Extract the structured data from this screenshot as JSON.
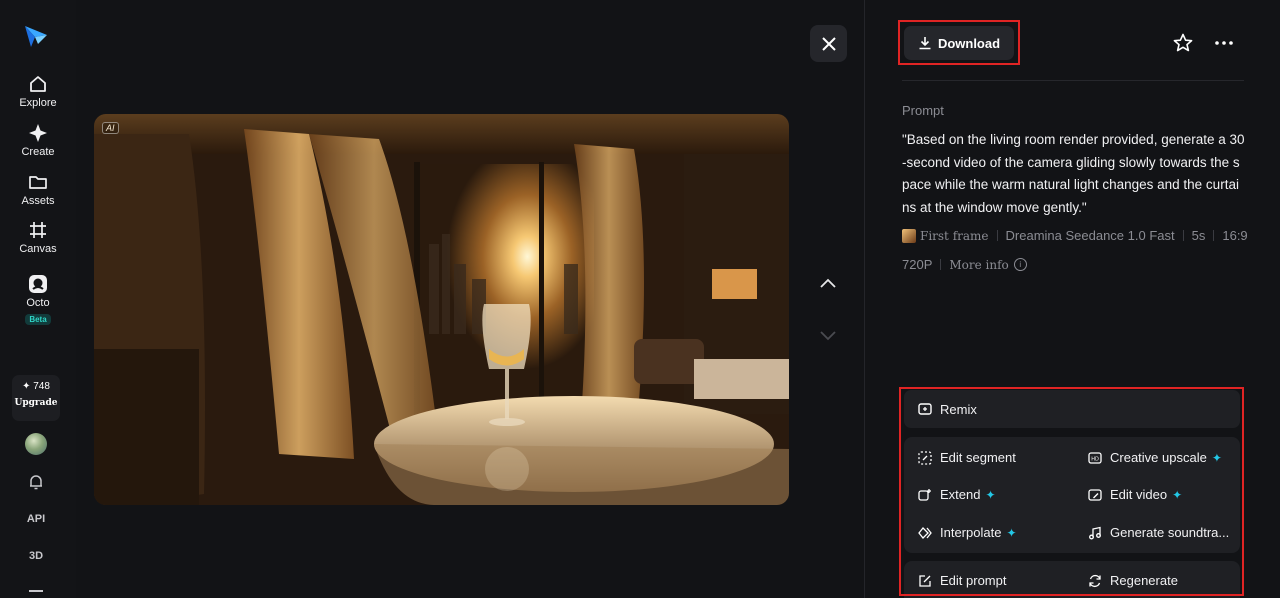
{
  "rail": {
    "nav": [
      {
        "label": "Explore",
        "icon": "home-icon"
      },
      {
        "label": "Create",
        "icon": "sparkle-icon"
      },
      {
        "label": "Assets",
        "icon": "folder-icon"
      },
      {
        "label": "Canvas",
        "icon": "canvas-icon"
      },
      {
        "label": "Octo",
        "icon": "octo-icon"
      }
    ],
    "octo_badge": "Beta",
    "credits": "748",
    "upgrade": "Upgrade",
    "api": "API",
    "three_d": "3D"
  },
  "viewer": {
    "ai_badge": "AI"
  },
  "panel": {
    "download": "Download",
    "prompt_label": "Prompt",
    "prompt_text": "\"Based on the living room render provided, generate a 30-second video of the camera gliding slowly towards the space while the warm natural light changes and the curtains at the window move gently.\"",
    "meta": {
      "first_frame": "First frame",
      "model": "Dreamina Seedance 1.0 Fast",
      "duration": "5s",
      "ratio": "16:9",
      "resolution": "720P",
      "more_info": "More info"
    },
    "actions": {
      "remix": "Remix",
      "edit_segment": "Edit segment",
      "creative_upscale": "Creative upscale",
      "extend": "Extend",
      "edit_video": "Edit video",
      "interpolate": "Interpolate",
      "generate_soundtrack": "Generate soundtra...",
      "edit_prompt": "Edit prompt",
      "regenerate": "Regenerate"
    }
  },
  "colors": {
    "background": "#121316",
    "panel": "#1f2024",
    "highlight": "#e02424",
    "accent": "#23c7e6"
  }
}
